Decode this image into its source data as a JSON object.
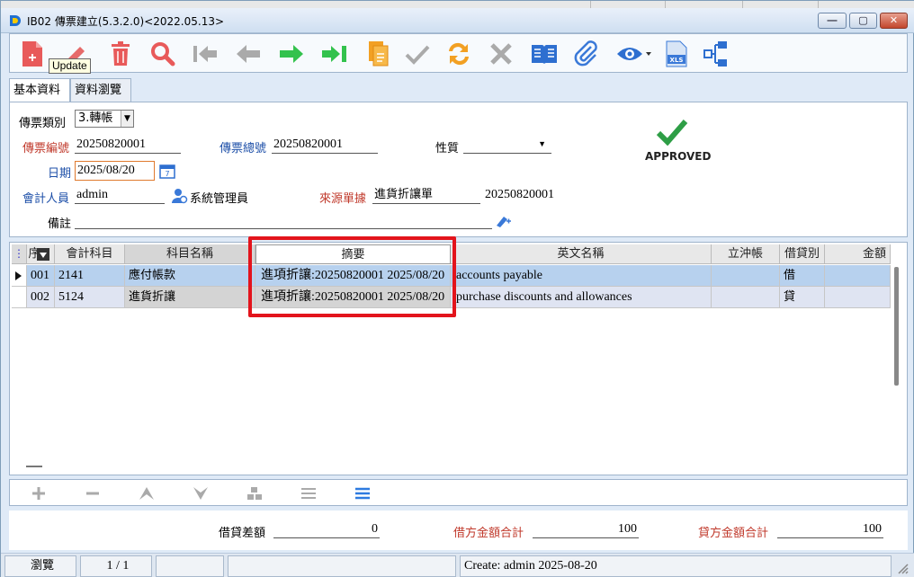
{
  "window": {
    "title": "IB02 傳票建立(5.3.2.0)<2022.05.13>",
    "min_label": "—",
    "max_label": "▢",
    "close_label": "✕"
  },
  "toolbar": {
    "tooltip": "Update",
    "icons": [
      "new-doc-icon",
      "edit-pencil-icon",
      "delete-trash-icon",
      "search-icon",
      "first-record-icon",
      "prev-record-icon",
      "next-record-icon",
      "last-record-icon",
      "copy-doc-icon",
      "confirm-check-icon",
      "refresh-swap-icon",
      "cancel-x-icon",
      "book-icon",
      "attach-icon",
      "view-eye-icon",
      "excel-export-icon",
      "flow-tree-icon"
    ]
  },
  "tabs": [
    {
      "label": "基本資料"
    },
    {
      "label": "資料瀏覽"
    }
  ],
  "form": {
    "voucher_type_label": "傳票類別",
    "voucher_type_value": "3.轉帳",
    "voucher_no_label": "傳票編號",
    "voucher_no_value": "20250820001",
    "voucher_total_no_label": "傳票總號",
    "voucher_total_no_value": "20250820001",
    "nature_label": "性質",
    "nature_value": "",
    "date_label": "日期",
    "date_value": "2025/08/20",
    "accountant_label": "會計人員",
    "accountant_value": "admin",
    "accountant_name": "系統管理員",
    "source_label": "來源單據",
    "source_type_value": "進貨折讓單",
    "source_no_value": "20250820001",
    "remark_label": "備註",
    "remark_value": "",
    "status_text": "APPROVED"
  },
  "grid": {
    "columns": [
      "序",
      "會計科目",
      "科目名稱",
      "摘要",
      "英文名稱",
      "立沖帳",
      "借貸別",
      "金額"
    ],
    "rows": [
      {
        "seq": "001",
        "account": "2141",
        "name": "應付帳款",
        "summary": "進項折讓:20250820001 2025/08/20",
        "english": "accounts payable",
        "offset": "",
        "dc": "借",
        "amount": ""
      },
      {
        "seq": "002",
        "account": "5124",
        "name": "進貨折讓",
        "summary": "進項折讓:20250820001 2025/08/20",
        "english": "purchase discounts and allowances",
        "offset": "",
        "dc": "貸",
        "amount": ""
      }
    ]
  },
  "totals": {
    "diff_label": "借貸差額",
    "diff_value": "0",
    "debit_label": "借方金額合計",
    "debit_value": "100",
    "credit_label": "貸方金額合計",
    "credit_value": "100"
  },
  "status": {
    "mode": "瀏覽",
    "page": "1 / 1",
    "created": "Create: admin 2025-08-20"
  },
  "colors": {
    "accent_red": "#e3141c",
    "approved_green": "#2e9e46",
    "selected_row": "#b7d1ee"
  }
}
